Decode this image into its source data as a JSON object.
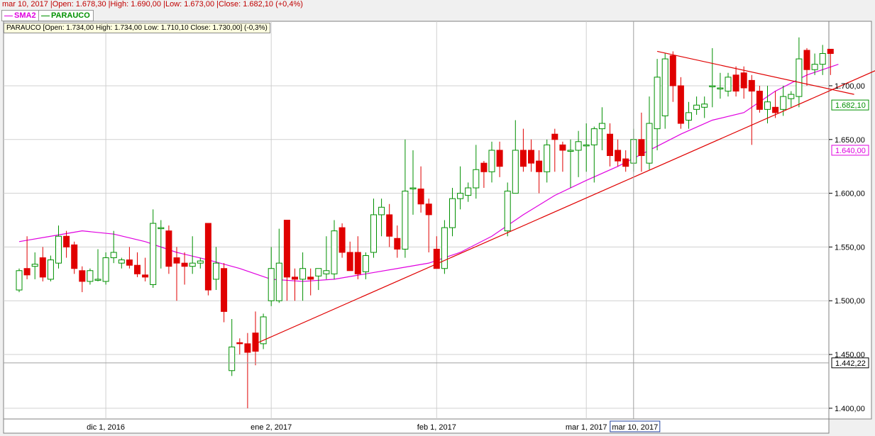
{
  "header": {
    "ohlc_text": "mar 10, 2017 |Open: 1.678,30 |High: 1.690,00 |Low: 1.673,00 |Close: 1.682,10 (+0,4%)"
  },
  "legend": {
    "items": [
      {
        "label": "SMA2",
        "color": "#e000e0"
      },
      {
        "label": "PARAUCO",
        "color": "#009000"
      }
    ]
  },
  "info_box": {
    "text": "PARAUCO [Open: 1.734,00  High: 1.734,00  Low: 1.710,10  Close: 1.730,00] (-0,3%)"
  },
  "colors": {
    "up": "#009000",
    "down": "#e00000",
    "sma": "#e000e0",
    "trendline": "#e00000",
    "grid": "#d0d0d0",
    "crosshair": "#a0a0a0"
  },
  "chart_data": {
    "type": "candlestick",
    "ylim": [
      1390,
      1760
    ],
    "y_ticks": [
      {
        "value": 1400,
        "label": "1.400,00"
      },
      {
        "value": 1450,
        "label": "1.450,00"
      },
      {
        "value": 1500,
        "label": "1.500,00"
      },
      {
        "value": 1550,
        "label": "1.550,00"
      },
      {
        "value": 1600,
        "label": "1.600,00"
      },
      {
        "value": 1650,
        "label": "1.650,00"
      },
      {
        "value": 1700,
        "label": "1.700,00"
      }
    ],
    "x_ticks": [
      {
        "index": 11,
        "label": "dic 1, 2016"
      },
      {
        "index": 32,
        "label": "ene 2, 2017"
      },
      {
        "index": 53,
        "label": "feb 1, 2017"
      },
      {
        "index": 72,
        "label": "mar 1, 2017"
      }
    ],
    "price_tags": [
      {
        "value": 1682.1,
        "label": "1.682,10",
        "color": "#009000"
      },
      {
        "value": 1640.0,
        "label": "1.640,00",
        "color": "#e000e0"
      },
      {
        "value": 1442.22,
        "label": "1.442,22",
        "color": "#000000"
      }
    ],
    "crosshair": {
      "index": 78,
      "value": 1442.22,
      "date_label": "mar 10, 2017"
    },
    "candles": [
      {
        "o": 1510,
        "h": 1530,
        "l": 1508,
        "c": 1528
      },
      {
        "o": 1530,
        "h": 1560,
        "l": 1520,
        "c": 1524
      },
      {
        "o": 1532,
        "h": 1545,
        "l": 1520,
        "c": 1534
      },
      {
        "o": 1540,
        "h": 1550,
        "l": 1518,
        "c": 1522
      },
      {
        "o": 1520,
        "h": 1542,
        "l": 1518,
        "c": 1538
      },
      {
        "o": 1535,
        "h": 1570,
        "l": 1530,
        "c": 1560
      },
      {
        "o": 1560,
        "h": 1565,
        "l": 1540,
        "c": 1550
      },
      {
        "o": 1552,
        "h": 1555,
        "l": 1525,
        "c": 1530
      },
      {
        "o": 1528,
        "h": 1532,
        "l": 1508,
        "c": 1518
      },
      {
        "o": 1518,
        "h": 1530,
        "l": 1515,
        "c": 1528
      },
      {
        "o": 1520,
        "h": 1548,
        "l": 1518,
        "c": 1520
      },
      {
        "o": 1518,
        "h": 1545,
        "l": 1515,
        "c": 1540
      },
      {
        "o": 1540,
        "h": 1565,
        "l": 1535,
        "c": 1545
      },
      {
        "o": 1535,
        "h": 1540,
        "l": 1530,
        "c": 1538
      },
      {
        "o": 1538,
        "h": 1550,
        "l": 1530,
        "c": 1533
      },
      {
        "o": 1533,
        "h": 1545,
        "l": 1522,
        "c": 1525
      },
      {
        "o": 1524,
        "h": 1540,
        "l": 1518,
        "c": 1522
      },
      {
        "o": 1515,
        "h": 1585,
        "l": 1512,
        "c": 1572
      },
      {
        "o": 1568,
        "h": 1575,
        "l": 1530,
        "c": 1568
      },
      {
        "o": 1565,
        "h": 1570,
        "l": 1525,
        "c": 1532
      },
      {
        "o": 1540,
        "h": 1550,
        "l": 1500,
        "c": 1535
      },
      {
        "o": 1535,
        "h": 1545,
        "l": 1515,
        "c": 1532
      },
      {
        "o": 1532,
        "h": 1560,
        "l": 1525,
        "c": 1535
      },
      {
        "o": 1535,
        "h": 1540,
        "l": 1530,
        "c": 1537
      },
      {
        "o": 1572,
        "h": 1572,
        "l": 1505,
        "c": 1510
      },
      {
        "o": 1520,
        "h": 1550,
        "l": 1510,
        "c": 1535
      },
      {
        "o": 1530,
        "h": 1535,
        "l": 1480,
        "c": 1490
      },
      {
        "o": 1435,
        "h": 1483,
        "l": 1430,
        "c": 1457
      },
      {
        "o": 1461,
        "h": 1465,
        "l": 1450,
        "c": 1460
      },
      {
        "o": 1460,
        "h": 1470,
        "l": 1400,
        "c": 1452
      },
      {
        "o": 1470,
        "h": 1490,
        "l": 1440,
        "c": 1453
      },
      {
        "o": 1460,
        "h": 1488,
        "l": 1455,
        "c": 1485
      },
      {
        "o": 1500,
        "h": 1550,
        "l": 1495,
        "c": 1530
      },
      {
        "o": 1500,
        "h": 1567,
        "l": 1498,
        "c": 1535
      },
      {
        "o": 1575,
        "h": 1575,
        "l": 1500,
        "c": 1522
      },
      {
        "o": 1522,
        "h": 1530,
        "l": 1500,
        "c": 1520
      },
      {
        "o": 1520,
        "h": 1545,
        "l": 1500,
        "c": 1530
      },
      {
        "o": 1522,
        "h": 1530,
        "l": 1505,
        "c": 1520
      },
      {
        "o": 1523,
        "h": 1530,
        "l": 1510,
        "c": 1530
      },
      {
        "o": 1525,
        "h": 1560,
        "l": 1520,
        "c": 1528
      },
      {
        "o": 1525,
        "h": 1575,
        "l": 1520,
        "c": 1565
      },
      {
        "o": 1568,
        "h": 1572,
        "l": 1540,
        "c": 1545
      },
      {
        "o": 1545,
        "h": 1555,
        "l": 1530,
        "c": 1528
      },
      {
        "o": 1545,
        "h": 1560,
        "l": 1520,
        "c": 1525
      },
      {
        "o": 1527,
        "h": 1545,
        "l": 1520,
        "c": 1542
      },
      {
        "o": 1545,
        "h": 1595,
        "l": 1540,
        "c": 1580
      },
      {
        "o": 1580,
        "h": 1595,
        "l": 1560,
        "c": 1587
      },
      {
        "o": 1580,
        "h": 1590,
        "l": 1550,
        "c": 1560
      },
      {
        "o": 1558,
        "h": 1570,
        "l": 1540,
        "c": 1548
      },
      {
        "o": 1548,
        "h": 1650,
        "l": 1540,
        "c": 1602
      },
      {
        "o": 1604,
        "h": 1640,
        "l": 1580,
        "c": 1605
      },
      {
        "o": 1604,
        "h": 1625,
        "l": 1582,
        "c": 1590
      },
      {
        "o": 1590,
        "h": 1595,
        "l": 1545,
        "c": 1580
      },
      {
        "o": 1548,
        "h": 1560,
        "l": 1530,
        "c": 1530
      },
      {
        "o": 1530,
        "h": 1575,
        "l": 1525,
        "c": 1568
      },
      {
        "o": 1568,
        "h": 1605,
        "l": 1560,
        "c": 1595
      },
      {
        "o": 1595,
        "h": 1625,
        "l": 1585,
        "c": 1600
      },
      {
        "o": 1598,
        "h": 1610,
        "l": 1592,
        "c": 1605
      },
      {
        "o": 1605,
        "h": 1645,
        "l": 1595,
        "c": 1622
      },
      {
        "o": 1628,
        "h": 1630,
        "l": 1605,
        "c": 1620
      },
      {
        "o": 1620,
        "h": 1648,
        "l": 1610,
        "c": 1640
      },
      {
        "o": 1640,
        "h": 1648,
        "l": 1615,
        "c": 1625
      },
      {
        "o": 1565,
        "h": 1610,
        "l": 1560,
        "c": 1602
      },
      {
        "o": 1600,
        "h": 1668,
        "l": 1600,
        "c": 1640
      },
      {
        "o": 1640,
        "h": 1660,
        "l": 1620,
        "c": 1625
      },
      {
        "o": 1640,
        "h": 1650,
        "l": 1620,
        "c": 1628
      },
      {
        "o": 1630,
        "h": 1640,
        "l": 1600,
        "c": 1620
      },
      {
        "o": 1620,
        "h": 1650,
        "l": 1610,
        "c": 1645
      },
      {
        "o": 1655,
        "h": 1660,
        "l": 1620,
        "c": 1650
      },
      {
        "o": 1645,
        "h": 1648,
        "l": 1620,
        "c": 1640
      },
      {
        "o": 1640,
        "h": 1650,
        "l": 1605,
        "c": 1640
      },
      {
        "o": 1640,
        "h": 1658,
        "l": 1615,
        "c": 1648
      },
      {
        "o": 1645,
        "h": 1665,
        "l": 1620,
        "c": 1645
      },
      {
        "o": 1645,
        "h": 1662,
        "l": 1610,
        "c": 1660
      },
      {
        "o": 1660,
        "h": 1680,
        "l": 1640,
        "c": 1665
      },
      {
        "o": 1655,
        "h": 1665,
        "l": 1625,
        "c": 1635
      },
      {
        "o": 1640,
        "h": 1650,
        "l": 1625,
        "c": 1630
      },
      {
        "o": 1632,
        "h": 1640,
        "l": 1620,
        "c": 1625
      },
      {
        "o": 1628,
        "h": 1660,
        "l": 1620,
        "c": 1650
      },
      {
        "o": 1650,
        "h": 1675,
        "l": 1620,
        "c": 1635
      },
      {
        "o": 1628,
        "h": 1690,
        "l": 1622,
        "c": 1665
      },
      {
        "o": 1660,
        "h": 1725,
        "l": 1640,
        "c": 1708
      },
      {
        "o": 1672,
        "h": 1730,
        "l": 1660,
        "c": 1725
      },
      {
        "o": 1728,
        "h": 1732,
        "l": 1685,
        "c": 1700
      },
      {
        "o": 1700,
        "h": 1708,
        "l": 1660,
        "c": 1665
      },
      {
        "o": 1668,
        "h": 1685,
        "l": 1660,
        "c": 1675
      },
      {
        "o": 1678,
        "h": 1690,
        "l": 1673,
        "c": 1682
      },
      {
        "o": 1680,
        "h": 1690,
        "l": 1670,
        "c": 1683
      },
      {
        "o": 1700,
        "h": 1735,
        "l": 1680,
        "c": 1700
      },
      {
        "o": 1698,
        "h": 1712,
        "l": 1688,
        "c": 1698
      },
      {
        "o": 1695,
        "h": 1712,
        "l": 1690,
        "c": 1708
      },
      {
        "o": 1710,
        "h": 1718,
        "l": 1690,
        "c": 1695
      },
      {
        "o": 1712,
        "h": 1718,
        "l": 1688,
        "c": 1698
      },
      {
        "o": 1705,
        "h": 1710,
        "l": 1645,
        "c": 1695
      },
      {
        "o": 1695,
        "h": 1700,
        "l": 1675,
        "c": 1678
      },
      {
        "o": 1678,
        "h": 1700,
        "l": 1665,
        "c": 1685
      },
      {
        "o": 1680,
        "h": 1695,
        "l": 1670,
        "c": 1675
      },
      {
        "o": 1678,
        "h": 1700,
        "l": 1672,
        "c": 1690
      },
      {
        "o": 1688,
        "h": 1695,
        "l": 1680,
        "c": 1692
      },
      {
        "o": 1690,
        "h": 1745,
        "l": 1680,
        "c": 1725
      },
      {
        "o": 1733,
        "h": 1735,
        "l": 1700,
        "c": 1715
      },
      {
        "o": 1715,
        "h": 1730,
        "l": 1710,
        "c": 1720
      },
      {
        "o": 1720,
        "h": 1738,
        "l": 1710,
        "c": 1730
      },
      {
        "o": 1734,
        "h": 1734,
        "l": 1710,
        "c": 1730
      }
    ],
    "sma": [
      [
        0,
        1555
      ],
      [
        4,
        1560
      ],
      [
        8,
        1565
      ],
      [
        12,
        1562
      ],
      [
        16,
        1555
      ],
      [
        20,
        1545
      ],
      [
        24,
        1538
      ],
      [
        28,
        1530
      ],
      [
        32,
        1520
      ],
      [
        36,
        1518
      ],
      [
        40,
        1520
      ],
      [
        44,
        1525
      ],
      [
        48,
        1530
      ],
      [
        52,
        1535
      ],
      [
        56,
        1545
      ],
      [
        60,
        1560
      ],
      [
        64,
        1580
      ],
      [
        68,
        1598
      ],
      [
        72,
        1612
      ],
      [
        76,
        1625
      ],
      [
        80,
        1640
      ],
      [
        84,
        1655
      ],
      [
        88,
        1668
      ],
      [
        92,
        1675
      ],
      [
        96,
        1695
      ],
      [
        100,
        1710
      ],
      [
        104,
        1720
      ]
    ],
    "trendlines": [
      {
        "start": [
          30,
          1460
        ],
        "end": [
          113,
          1728
        ]
      },
      {
        "start": [
          81,
          1732
        ],
        "end": [
          106,
          1692
        ]
      }
    ]
  }
}
